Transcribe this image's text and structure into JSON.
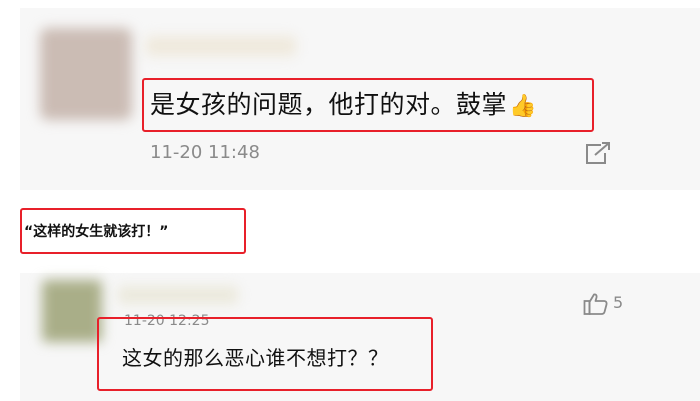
{
  "comment_top": {
    "text": "是女孩的问题，他打的对。鼓掌",
    "emoji": "👍",
    "time": "11-20 11:48",
    "share_icon": "share-external-icon"
  },
  "caption": {
    "text": "“这样的女生就该打！”"
  },
  "comment_bottom": {
    "time": "11-20 12:25",
    "text": "这女的那么恶心谁不想打？？",
    "like_icon": "thumbs-up-outline-icon",
    "like_count": "5"
  },
  "colors": {
    "highlight_border": "#e8202a",
    "panel_bg": "#f7f7f7",
    "meta_text": "#8a8a8a"
  }
}
